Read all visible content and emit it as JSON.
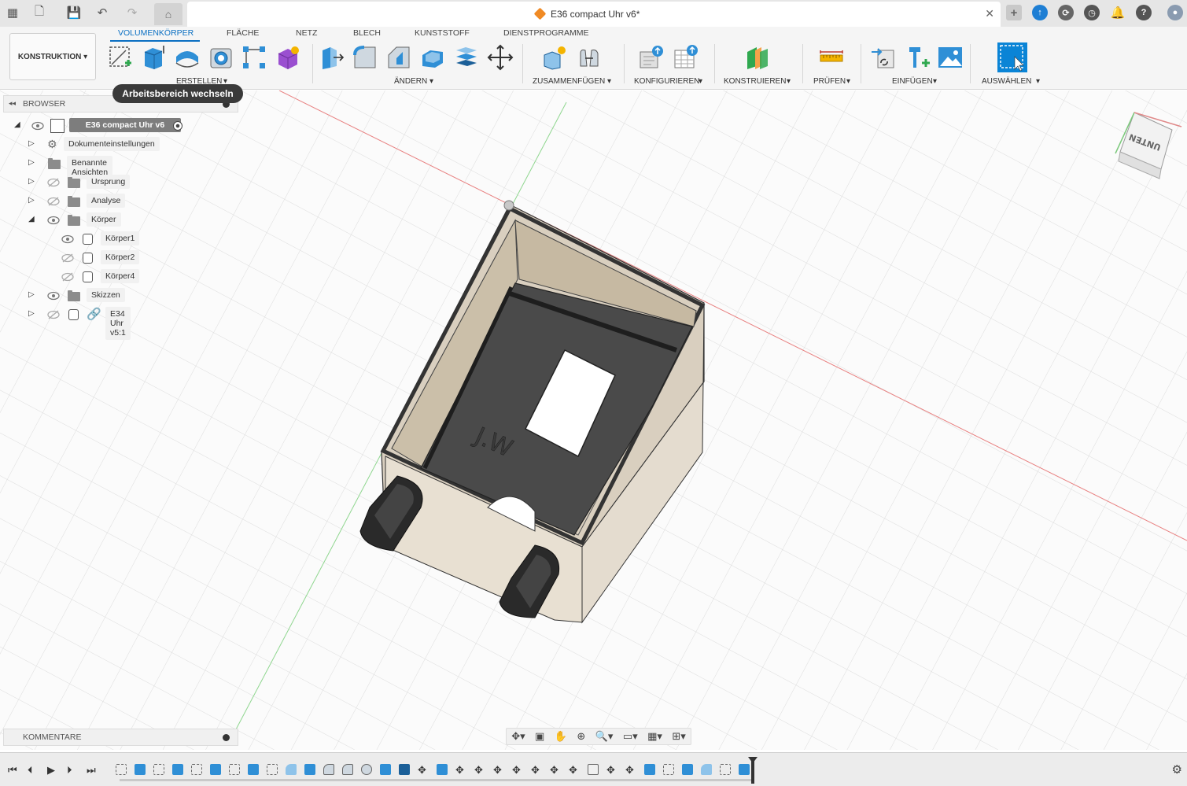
{
  "window": {
    "title": "E36 compact Uhr v6*"
  },
  "toolbar": {
    "workspace_label": "KONSTRUKTION",
    "tabs": [
      {
        "label": "VOLUMENKÖRPER",
        "active": true
      },
      {
        "label": "FLÄCHE"
      },
      {
        "label": "NETZ"
      },
      {
        "label": "BLECH"
      },
      {
        "label": "KUNSTSTOFF"
      },
      {
        "label": "DIENSTPROGRAMME"
      }
    ],
    "groups": {
      "erstellen": "ERSTELLEN",
      "aendern": "ÄNDERN",
      "zusammenfuegen": "ZUSAMMENFÜGEN",
      "konfigurieren": "KONFIGURIEREN",
      "konstruieren": "KONSTRUIEREN",
      "pruefen": "PRÜFEN",
      "einfuegen": "EINFÜGEN",
      "auswaehlen": "AUSWÄHLEN"
    },
    "tooltip": "Arbeitsbereich wechseln"
  },
  "browser": {
    "title": "BROWSER",
    "root": "E36 compact Uhr v6",
    "items": [
      {
        "label": "Dokumenteinstellungen",
        "icon": "gear-icon"
      },
      {
        "label": "Benannte Ansichten",
        "icon": "folder-icon"
      },
      {
        "label": "Ursprung",
        "icon": "folder-icon",
        "visible": false
      },
      {
        "label": "Analyse",
        "icon": "folder-icon",
        "visible": false
      },
      {
        "label": "Körper",
        "icon": "folder-icon",
        "visible": true,
        "expanded": true
      },
      {
        "label": "Körper1",
        "icon": "body-icon",
        "visible": true
      },
      {
        "label": "Körper2",
        "icon": "body-icon",
        "visible": false
      },
      {
        "label": "Körper4",
        "icon": "body-icon",
        "visible": false
      },
      {
        "label": "Skizzen",
        "icon": "folder-icon",
        "visible": true
      },
      {
        "label": "E34 Uhr v5:1",
        "icon": "link-icon",
        "visible": false
      }
    ]
  },
  "viewcube": {
    "face": "UNTEN"
  },
  "model": {
    "engraving": "J.W"
  },
  "comments": {
    "label": "KOMMENTARE"
  },
  "colors": {
    "accent": "#0a6fc2",
    "tool_blue": "#2f8fd6",
    "body_beige": "#d9cfbf",
    "floor_dark": "#4a4a4a"
  }
}
